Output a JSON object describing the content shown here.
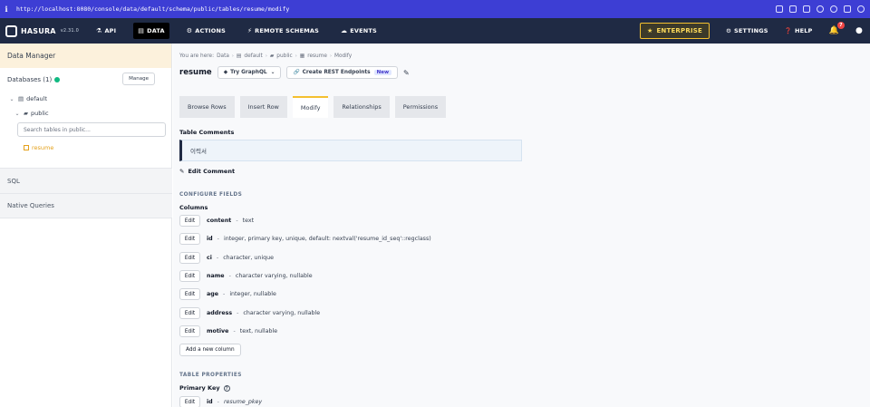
{
  "browser": {
    "info_glyph": "i",
    "url": "http://localhost:8080/console/data/default/schema/public/tables/resume/modify"
  },
  "topnav": {
    "brand": "HASURA",
    "version": "v2.31.0",
    "items": [
      {
        "label": "API",
        "icon": "api-icon"
      },
      {
        "label": "DATA",
        "icon": "database-icon",
        "active": true
      },
      {
        "label": "ACTIONS",
        "icon": "actions-icon"
      },
      {
        "label": "REMOTE SCHEMAS",
        "icon": "remote-schemas-icon"
      },
      {
        "label": "EVENTS",
        "icon": "events-icon"
      }
    ],
    "enterprise": "ENTERPRISE",
    "settings": "SETTINGS",
    "help": "HELP",
    "notification_count": "7"
  },
  "sidebar": {
    "header": "Data Manager",
    "databases_label": "Databases (1)",
    "manage_label": "Manage",
    "database": "default",
    "schema": "public",
    "search_placeholder": "Search tables in public...",
    "table": "resume",
    "sql": "SQL",
    "native_queries": "Native Queries"
  },
  "main": {
    "breadcrumb": {
      "prefix": "You are here:",
      "items": [
        "Data",
        "default",
        "public",
        "resume",
        "Modify"
      ]
    },
    "title": "resume",
    "try_graphql": "Try GraphQL",
    "create_rest": "Create REST Endpoints",
    "new_badge": "New",
    "tabs": [
      "Browse Rows",
      "Insert Row",
      "Modify",
      "Relationships",
      "Permissions"
    ],
    "active_tab": "Modify",
    "table_comments_label": "Table Comments",
    "comment": "이력서",
    "edit_comment": "Edit Comment",
    "configure_fields": "CONFIGURE FIELDS",
    "columns_label": "Columns",
    "edit_label": "Edit",
    "columns": [
      {
        "name": "content",
        "type": "text"
      },
      {
        "name": "id",
        "type": "integer, primary key, unique, default: nextval('resume_id_seq'::regclass)"
      },
      {
        "name": "ci",
        "type": "character, unique"
      },
      {
        "name": "name",
        "type": "character varying, nullable"
      },
      {
        "name": "age",
        "type": "integer, nullable"
      },
      {
        "name": "address",
        "type": "character varying, nullable"
      },
      {
        "name": "motive",
        "type": "text, nullable"
      }
    ],
    "add_column": "Add a new column",
    "table_properties": "TABLE PROPERTIES",
    "primary_key_label": "Primary Key",
    "pk_column": "id",
    "pk_name": "resume_pkey"
  }
}
